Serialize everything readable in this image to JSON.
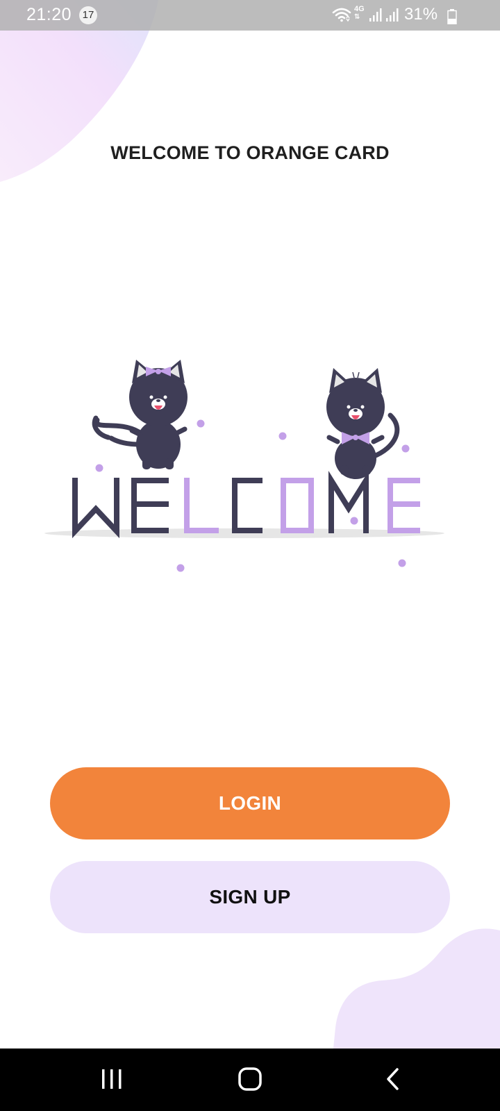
{
  "status_bar": {
    "time": "21:20",
    "notification_count": "17",
    "network": "4G",
    "battery_percent": "31%",
    "icons": [
      "wifi-icon",
      "4g-icon",
      "signal-icon",
      "signal-icon",
      "battery-icon"
    ]
  },
  "welcome": {
    "heading": "WELCOME TO ORANGE CARD"
  },
  "illustration": {
    "word": "WELCOME",
    "colors": {
      "dark": "#3f3d56",
      "accent": "#c3a0e8",
      "shadow": "#e6e6e6"
    }
  },
  "actions": {
    "login_label": "LOGIN",
    "signup_label": "SIGN UP"
  },
  "colors": {
    "primary": "#f2843b",
    "secondary": "#ede3fb",
    "blob": "#efe4fb"
  },
  "nav_bar": {
    "icons": [
      "recents-icon",
      "home-icon",
      "back-icon"
    ]
  }
}
